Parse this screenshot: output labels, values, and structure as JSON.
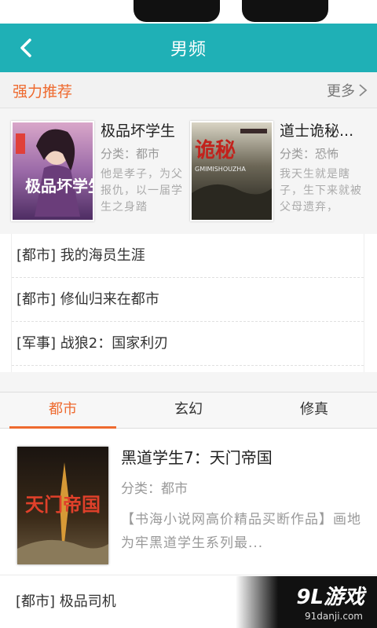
{
  "nav": {
    "title": "男频"
  },
  "recommend": {
    "title": "强力推荐",
    "more_label": "更多",
    "featured": [
      {
        "title": "极品坏学生",
        "category": "分类：都市",
        "description": "他是孝子，为父报仇，以一届学生之身踏",
        "cover_text": "极品坏学生"
      },
      {
        "title": "道士诡秘...",
        "category": "分类：恐怖",
        "description": "我天生就是瞎子，生下来就被父母遗弃，",
        "cover_text": "诡秘",
        "cover_sub": "GMIMISHOUZHA"
      }
    ],
    "list": [
      {
        "label": "[都市] 我的海员生涯"
      },
      {
        "label": "[都市] 修仙归来在都市"
      },
      {
        "label": "[军事] 战狼2：国家利刃"
      }
    ]
  },
  "tabs": [
    {
      "label": "都市",
      "active": true
    },
    {
      "label": "玄幻",
      "active": false
    },
    {
      "label": "修真",
      "active": false
    }
  ],
  "book": {
    "title": "黑道学生7：天门帝国",
    "category": "分类：都市",
    "description": "【书海小说网高价精品买断作品】画地为牢黑道学生系列最...",
    "cover_text": "天门帝国"
  },
  "bottom": {
    "label": "[都市] 极品司机"
  },
  "watermark": {
    "text": "9L游戏",
    "url": "91danji.com"
  },
  "colors": {
    "nav_bg": "#1fb0b6",
    "accent": "#ee6a2f"
  }
}
